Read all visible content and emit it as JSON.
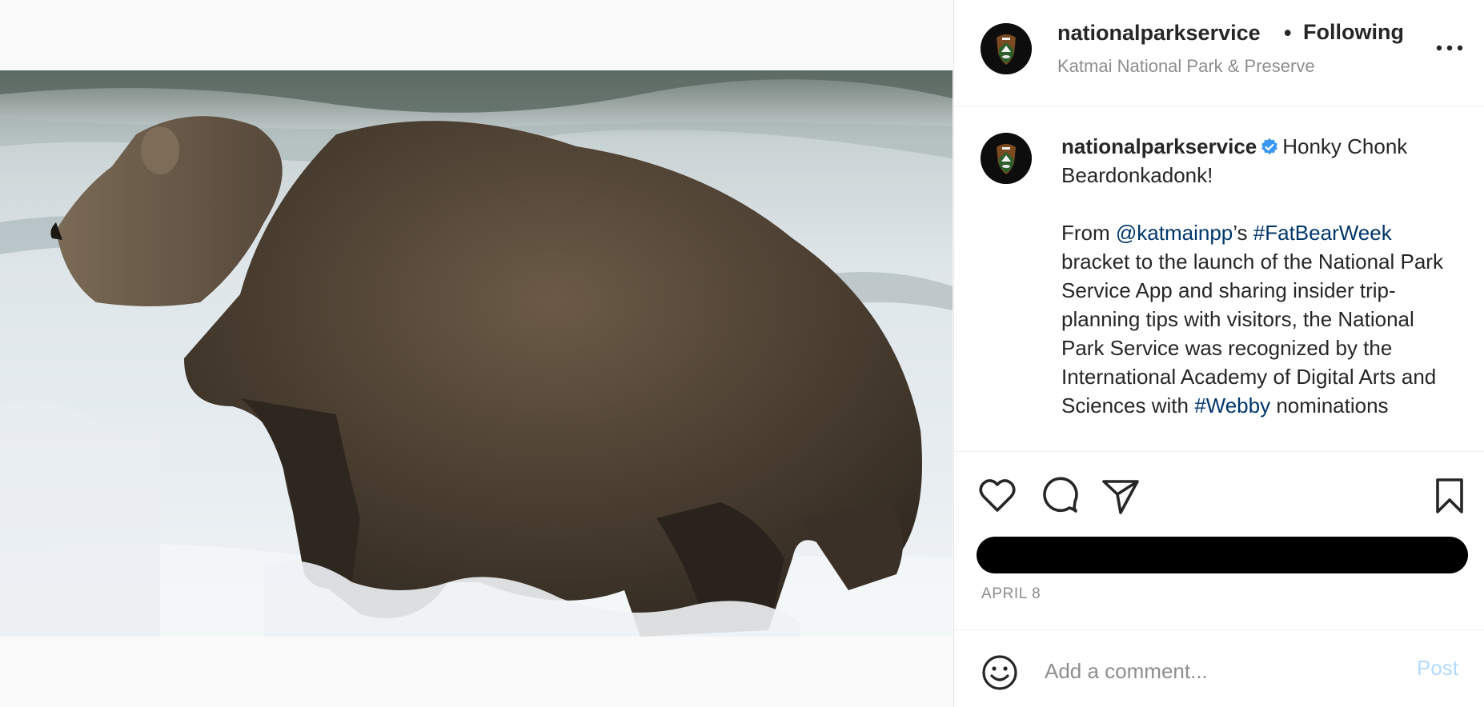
{
  "header": {
    "username": "nationalparkservice",
    "separator": "•",
    "follow_label": "Following",
    "location": "Katmai National Park & Preserve",
    "more_icon": "more-horizontal-icon"
  },
  "caption": {
    "username": "nationalparkservice",
    "verified_icon": "verified-badge-icon",
    "headline": "Honky Chonk Beardonkadonk!",
    "body": {
      "t1": "From ",
      "m1": "@katmainpp",
      "t2": "’s ",
      "h1": "#FatBearWeek",
      "t3": " bracket to the launch of the National Park Service App and sharing insider trip-planning tips with visitors, the National Park Service was recognized by the International Academy of Digital Arts and Sciences with ",
      "h2": "#Webby",
      "t4": " nominations"
    }
  },
  "actions": {
    "like_icon": "heart-icon",
    "comment_icon": "comment-icon",
    "share_icon": "send-icon",
    "save_icon": "bookmark-icon"
  },
  "date": "APRIL 8",
  "comment": {
    "emoji_icon": "emoji-icon",
    "placeholder": "Add a comment...",
    "post_label": "Post"
  },
  "colors": {
    "link": "#00376b",
    "verified": "#3897f0",
    "secondary_text": "#8e8e8e",
    "post_disabled": "#b3dbff"
  }
}
